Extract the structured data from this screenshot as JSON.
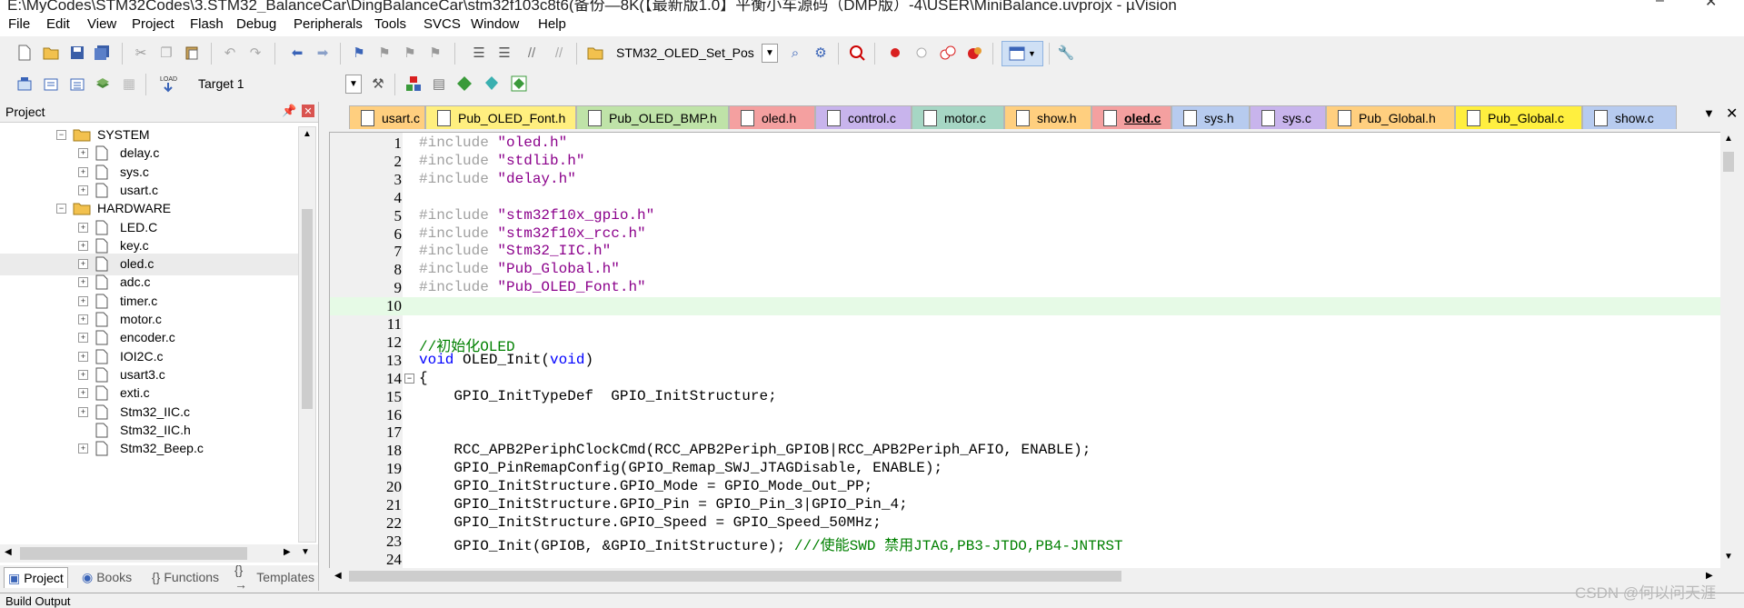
{
  "window": {
    "title": "E:\\MyCodes\\STM32Codes\\3.STM32_BalanceCar\\DingBalanceCar\\stm32f103c8t6(备份—8K(【最新版1.0】平衡小车源码（DMP版）-4\\USER\\MiniBalance.uvprojx - µVision"
  },
  "menu": [
    "File",
    "Edit",
    "View",
    "Project",
    "Flash",
    "Debug",
    "Peripherals",
    "Tools",
    "SVCS",
    "Window",
    "Help"
  ],
  "toolbar": {
    "target_combo": "STM32_OLED_Set_Pos",
    "target_select": "Target 1"
  },
  "project_panel": {
    "title": "Project",
    "tree": [
      {
        "label": "SYSTEM",
        "type": "folder",
        "expanded": true
      },
      {
        "label": "delay.c",
        "type": "file"
      },
      {
        "label": "sys.c",
        "type": "file"
      },
      {
        "label": "usart.c",
        "type": "file"
      },
      {
        "label": "HARDWARE",
        "type": "folder",
        "expanded": true
      },
      {
        "label": "LED.C",
        "type": "file"
      },
      {
        "label": "key.c",
        "type": "file"
      },
      {
        "label": "oled.c",
        "type": "file",
        "selected": true
      },
      {
        "label": "adc.c",
        "type": "file"
      },
      {
        "label": "timer.c",
        "type": "file"
      },
      {
        "label": "motor.c",
        "type": "file"
      },
      {
        "label": "encoder.c",
        "type": "file"
      },
      {
        "label": "IOI2C.c",
        "type": "file"
      },
      {
        "label": "usart3.c",
        "type": "file"
      },
      {
        "label": "exti.c",
        "type": "file"
      },
      {
        "label": "Stm32_IIC.c",
        "type": "file"
      },
      {
        "label": "Stm32_IIC.h",
        "type": "file",
        "no_expander": true
      },
      {
        "label": "Stm32_Beep.c",
        "type": "file"
      }
    ],
    "bottom_tabs": [
      "Project",
      "Books",
      "Functions",
      "Templates"
    ]
  },
  "file_tabs": [
    {
      "label": "usart.c",
      "color": "#ffcf7f"
    },
    {
      "label": "Pub_OLED_Font.h",
      "color": "#ffef7f"
    },
    {
      "label": "Pub_OLED_BMP.h",
      "color": "#bfe3a8"
    },
    {
      "label": "oled.h",
      "color": "#f4a0a0"
    },
    {
      "label": "control.c",
      "color": "#c8b4ec"
    },
    {
      "label": "motor.c",
      "color": "#a6d6c4"
    },
    {
      "label": "show.h",
      "color": "#ffcf7f"
    },
    {
      "label": "oled.c",
      "color": "#f4a0a0",
      "active": true
    },
    {
      "label": "sys.h",
      "color": "#b7cbef"
    },
    {
      "label": "sys.c",
      "color": "#c8b4ec"
    },
    {
      "label": "Pub_Global.h",
      "color": "#ffcf7f"
    },
    {
      "label": "Pub_Global.c",
      "color": "#ffef3f"
    },
    {
      "label": "show.c",
      "color": "#b7cbef"
    }
  ],
  "code_lines": [
    {
      "n": "1",
      "segs": [
        [
          "pp",
          "#include "
        ],
        [
          "str",
          "\"oled.h\""
        ]
      ]
    },
    {
      "n": "2",
      "segs": [
        [
          "pp",
          "#include "
        ],
        [
          "str",
          "\"stdlib.h\""
        ]
      ]
    },
    {
      "n": "3",
      "segs": [
        [
          "pp",
          "#include "
        ],
        [
          "str",
          "\"delay.h\""
        ]
      ]
    },
    {
      "n": "4",
      "segs": []
    },
    {
      "n": "5",
      "segs": [
        [
          "pp",
          "#include "
        ],
        [
          "str",
          "\"stm32f10x_gpio.h\""
        ]
      ]
    },
    {
      "n": "6",
      "segs": [
        [
          "pp",
          "#include "
        ],
        [
          "str",
          "\"stm32f10x_rcc.h\""
        ]
      ]
    },
    {
      "n": "7",
      "segs": [
        [
          "pp",
          "#include "
        ],
        [
          "str",
          "\"Stm32_IIC.h\""
        ]
      ]
    },
    {
      "n": "8",
      "segs": [
        [
          "pp",
          "#include "
        ],
        [
          "str",
          "\"Pub_Global.h\""
        ]
      ]
    },
    {
      "n": "9",
      "segs": [
        [
          "pp",
          "#include "
        ],
        [
          "str",
          "\"Pub_OLED_Font.h\""
        ]
      ]
    },
    {
      "n": "10",
      "segs": [],
      "current": true
    },
    {
      "n": "11",
      "segs": []
    },
    {
      "n": "12",
      "segs": [
        [
          "cmt",
          "//初始化OLED"
        ]
      ]
    },
    {
      "n": "13",
      "segs": [
        [
          "kw",
          "void"
        ],
        [
          "plain",
          " OLED_Init("
        ],
        [
          "kw",
          "void"
        ],
        [
          "plain",
          ")"
        ]
      ]
    },
    {
      "n": "14",
      "segs": [
        [
          "plain",
          "{"
        ]
      ],
      "fold": true
    },
    {
      "n": "15",
      "segs": [
        [
          "plain",
          "    GPIO_InitTypeDef  GPIO_InitStructure;"
        ]
      ]
    },
    {
      "n": "16",
      "segs": []
    },
    {
      "n": "17",
      "segs": []
    },
    {
      "n": "18",
      "segs": [
        [
          "plain",
          "    RCC_APB2PeriphClockCmd(RCC_APB2Periph_GPIOB|RCC_APB2Periph_AFIO, ENABLE);"
        ]
      ]
    },
    {
      "n": "19",
      "segs": [
        [
          "plain",
          "    GPIO_PinRemapConfig(GPIO_Remap_SWJ_JTAGDisable, ENABLE);"
        ]
      ]
    },
    {
      "n": "20",
      "segs": [
        [
          "plain",
          "    GPIO_InitStructure.GPIO_Mode = GPIO_Mode_Out_PP;"
        ]
      ]
    },
    {
      "n": "21",
      "segs": [
        [
          "plain",
          "    GPIO_InitStructure.GPIO_Pin = GPIO_Pin_3|GPIO_Pin_4;"
        ]
      ]
    },
    {
      "n": "22",
      "segs": [
        [
          "plain",
          "    GPIO_InitStructure.GPIO_Speed = GPIO_Speed_50MHz;"
        ]
      ]
    },
    {
      "n": "23",
      "segs": [
        [
          "plain",
          "    GPIO_Init(GPIOB, &GPIO_InitStructure); "
        ],
        [
          "cmt",
          "///使能SWD 禁用JTAG,PB3-JTDO,PB4-JNTRST"
        ]
      ]
    },
    {
      "n": "24",
      "segs": []
    }
  ],
  "build_output": {
    "title": "Build Output"
  },
  "watermark": "CSDN @何以问天涯"
}
